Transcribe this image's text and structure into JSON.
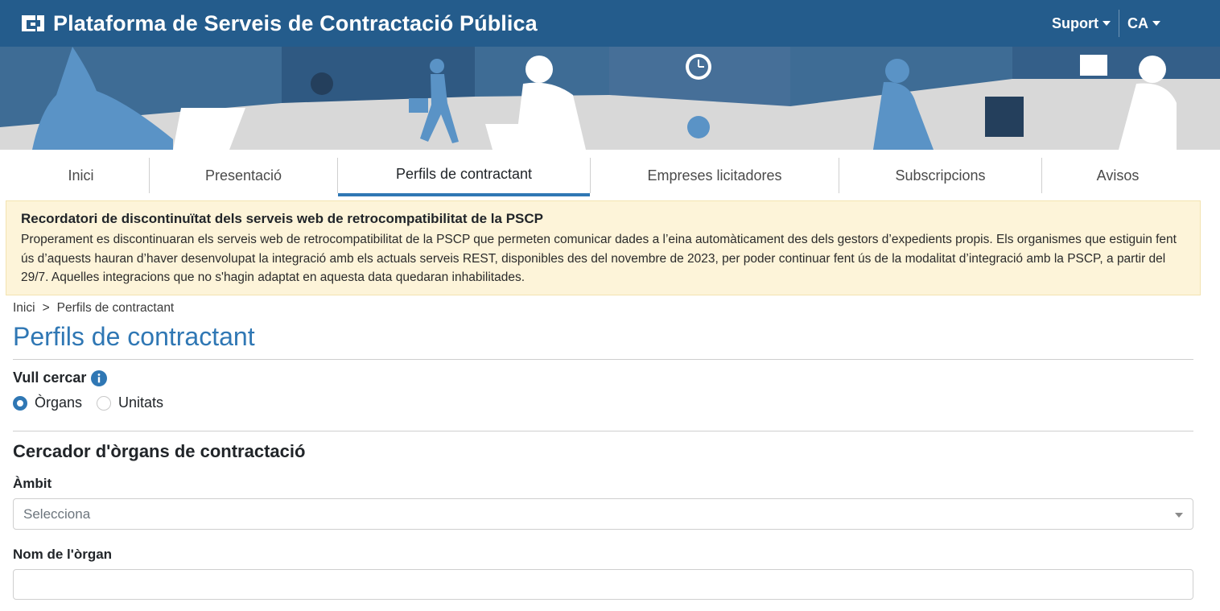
{
  "header": {
    "title": "Plataforma de Serveis de Contractació Pública",
    "menu": [
      {
        "label": "Suport"
      },
      {
        "label": "CA"
      }
    ]
  },
  "nav": {
    "tabs": [
      {
        "label": "Inici"
      },
      {
        "label": "Presentació"
      },
      {
        "label": "Perfils de contractant"
      },
      {
        "label": "Empreses licitadores"
      },
      {
        "label": "Subscripcions"
      },
      {
        "label": "Avisos"
      }
    ],
    "active": "Perfils de contractant"
  },
  "alert": {
    "title": "Recordatori de discontinuïtat dels serveis web de retrocompatibilitat de la PSCP",
    "text": "Properament es discontinuaran els serveis web de retrocompatibilitat de la PSCP que permeten comunicar dades a l’eina automàticament des dels gestors d’expedients propis. Els organismes que estiguin fent ús d’aquests hauran d’haver desenvolupat la integració amb els actuals serveis REST, disponibles des del novembre de 2023, per poder continuar fent ús de la modalitat d’integració amb la PSCP, a partir del 29/7. Aquelles integracions que no s'hagin adaptat en aquesta data quedaran inhabilitades."
  },
  "breadcrumb": {
    "items": [
      "Inici",
      "Perfils de contractant"
    ],
    "separator": ">"
  },
  "page": {
    "title": "Perfils de contractant",
    "search_label": "Vull cercar",
    "radios": [
      {
        "label": "Òrgans",
        "checked": true
      },
      {
        "label": "Unitats",
        "checked": false
      }
    ],
    "section_title": "Cercador d'òrgans de contractació",
    "ambit_label": "Àmbit",
    "ambit_placeholder": "Selecciona",
    "nom_label": "Nom de l'òrgan",
    "nom_value": ""
  },
  "colors": {
    "header_bg": "#245c8c",
    "accent": "#2f77b4",
    "alert_bg": "#fdf4d9"
  },
  "icons": {
    "brand": "brand-logo-icon",
    "info": "info-icon",
    "caret": "caret-down-icon"
  }
}
